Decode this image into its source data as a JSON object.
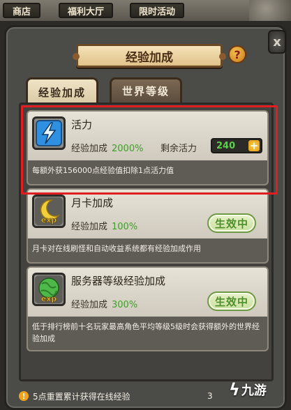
{
  "top_tabs": [
    {
      "label": "商店"
    },
    {
      "label": "福利大厅"
    },
    {
      "label": "限时活动"
    }
  ],
  "window": {
    "title": "经验加成",
    "help_icon": "question-mark",
    "close_icon": "x"
  },
  "sub_tabs": [
    {
      "label": "经验加成",
      "active": true
    },
    {
      "label": "世界等级",
      "active": false
    }
  ],
  "cards": [
    {
      "name": "活力",
      "icon": "lightning-icon",
      "bonus_label": "经验加成",
      "bonus_value": "2000%",
      "remain_label": "剩余活力",
      "remain_value": "240",
      "description": "每额外获156000点经验值扣除1点活力值"
    },
    {
      "name": "月卡加成",
      "icon": "moon-exp-icon",
      "icon_text": "exp",
      "bonus_label": "经验加成",
      "bonus_value": "100%",
      "status": "生效中",
      "description": "月卡对在线刷怪和自动收益系统都有经验加成作用"
    },
    {
      "name": "服务器等级经验加成",
      "icon": "globe-exp-icon",
      "icon_text": "exp",
      "bonus_label": "经验加成",
      "bonus_value": "300%",
      "status": "生效中",
      "description": "低于排行榜前十名玩家最高角色平均等级5级时会获得额外的世界经验加成"
    }
  ],
  "footer": {
    "icon": "!",
    "text": "5点重置累计获得在线经验",
    "number": "3"
  },
  "logo": {
    "mark": "ϟ",
    "text": "九游"
  },
  "colors": {
    "bonus_green": "#3f9e2a",
    "remain_green": "#5ad14a",
    "highlight_red": "#e01e22",
    "title_bg": "#e8cf9a"
  }
}
